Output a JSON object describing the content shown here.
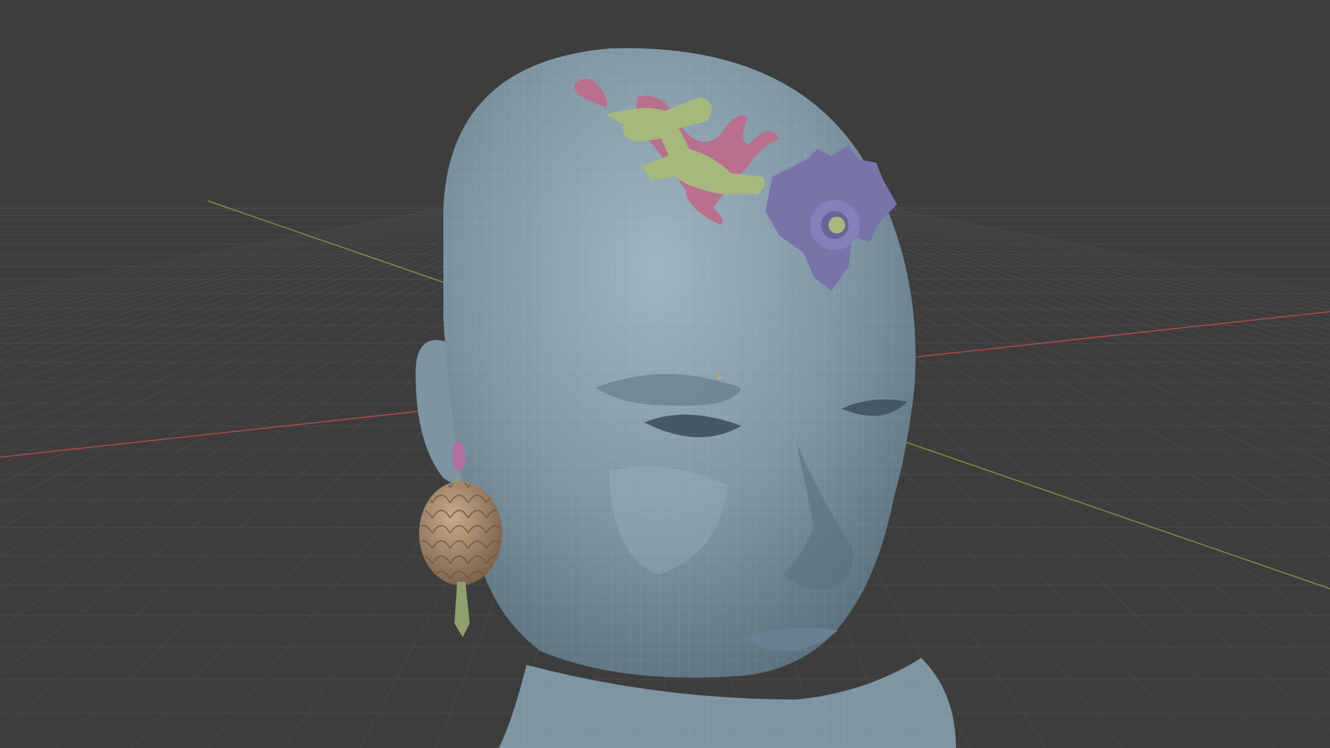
{
  "viewport": {
    "kind": "3d-viewport",
    "shading": "solid-wireframe",
    "background_color": "#3d3d3d",
    "grid_line_color": "#4a4a4a",
    "x_axis_color": "#b84a4a",
    "y_axis_color": "#7a9a3a",
    "origin_color": "#e8a040"
  },
  "objects": [
    {
      "name": "head",
      "color": "#7d94a3"
    },
    {
      "name": "headpiece-green-scroll",
      "color": "#a7b87d"
    },
    {
      "name": "headpiece-pink-scroll",
      "color": "#b8708d"
    },
    {
      "name": "headpiece-purple-sun",
      "color": "#7873a8"
    },
    {
      "name": "headpiece-pink-drop",
      "color": "#b8708d"
    },
    {
      "name": "earring-cone",
      "color": "#a88a6e"
    },
    {
      "name": "earring-stem",
      "color": "#8fa06e"
    },
    {
      "name": "earring-hook",
      "color": "#b070a0"
    }
  ]
}
